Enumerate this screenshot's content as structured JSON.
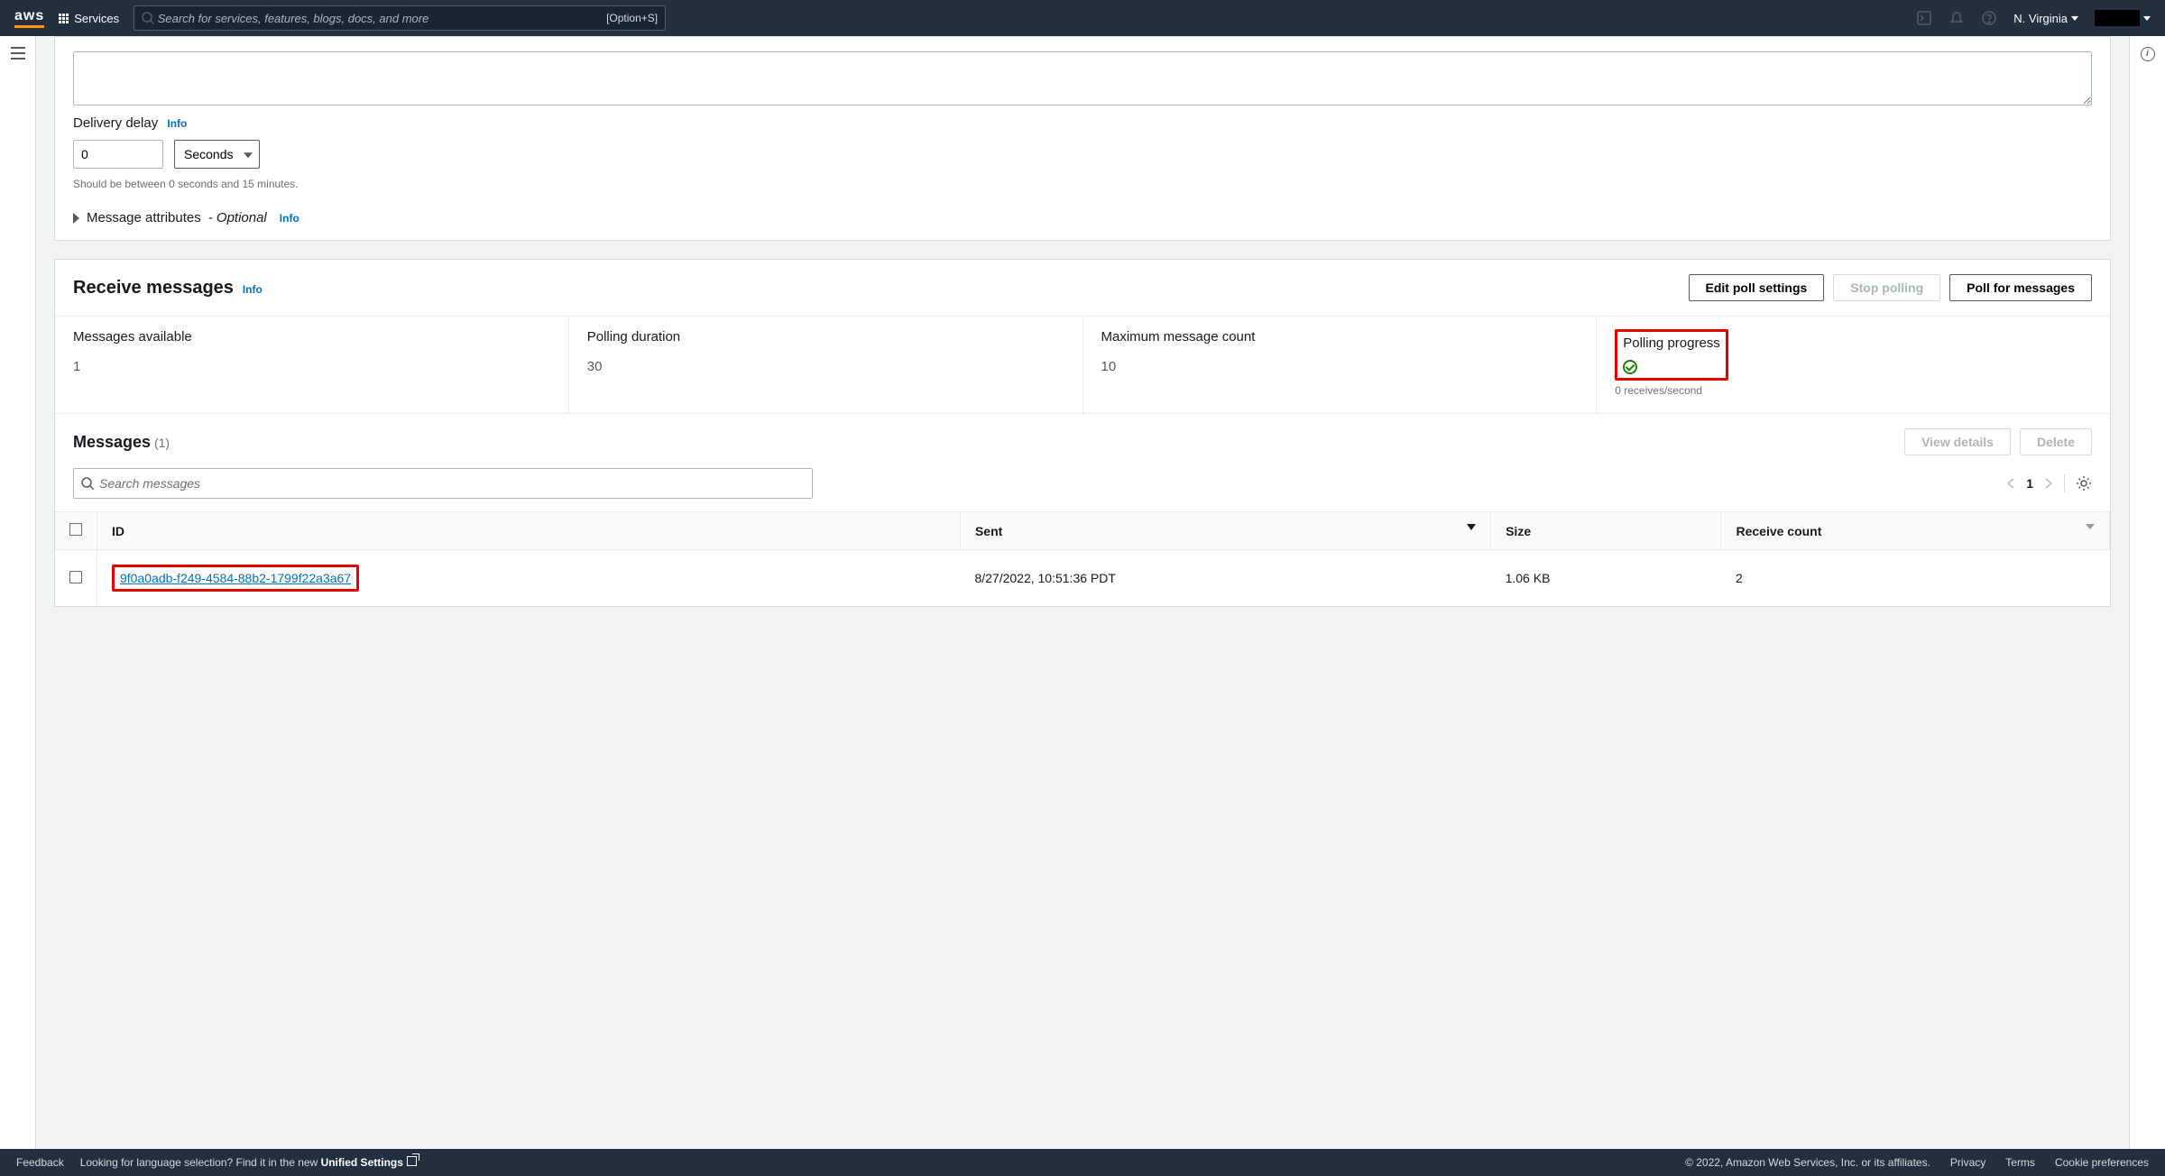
{
  "nav": {
    "logo": "aws",
    "services": "Services",
    "search_placeholder": "Search for services, features, blogs, docs, and more",
    "shortcut": "[Option+S]",
    "region": "N. Virginia"
  },
  "send": {
    "delay_label": "Delivery delay",
    "info": "Info",
    "delay_value": "0",
    "unit_selected": "Seconds",
    "hint": "Should be between 0 seconds and 15 minutes.",
    "attributes": "Message attributes",
    "optional": "- Optional"
  },
  "receive": {
    "title": "Receive messages",
    "info": "Info",
    "buttons": {
      "edit": "Edit poll settings",
      "stop": "Stop polling",
      "poll": "Poll for messages"
    },
    "stats": {
      "available_label": "Messages available",
      "available_value": "1",
      "duration_label": "Polling duration",
      "duration_value": "30",
      "max_label": "Maximum message count",
      "max_value": "10",
      "progress_label": "Polling progress",
      "progress_sub": "0 receives/second"
    }
  },
  "messages": {
    "title": "Messages",
    "count": "(1)",
    "view_details": "View details",
    "delete": "Delete",
    "search_placeholder": "Search messages",
    "page": "1",
    "cols": {
      "id": "ID",
      "sent": "Sent",
      "size": "Size",
      "receive": "Receive count"
    },
    "rows": [
      {
        "id": "9f0a0adb-f249-4584-88b2-1799f22a3a67",
        "sent": "8/27/2022, 10:51:36 PDT",
        "size": "1.06 KB",
        "receive": "2"
      }
    ]
  },
  "footer": {
    "feedback": "Feedback",
    "lang_prompt": "Looking for language selection? Find it in the new",
    "unified": "Unified Settings",
    "copyright": "© 2022, Amazon Web Services, Inc. or its affiliates.",
    "privacy": "Privacy",
    "terms": "Terms",
    "cookie": "Cookie preferences"
  }
}
